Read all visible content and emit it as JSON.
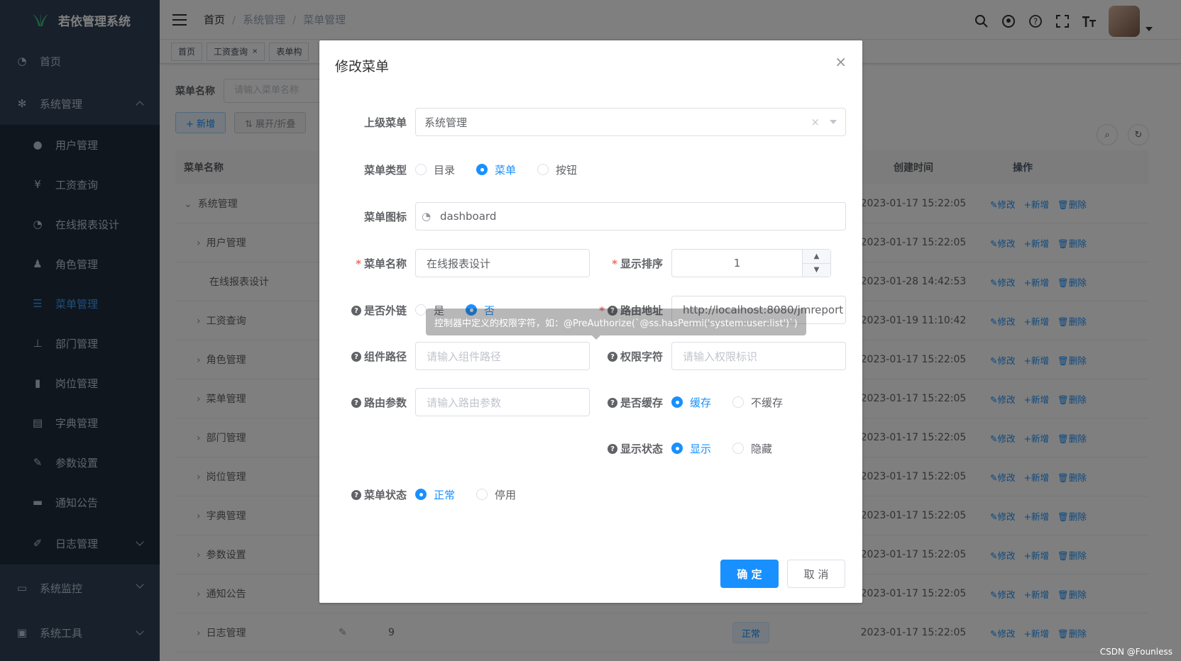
{
  "app": {
    "title": "若依管理系统"
  },
  "sidebar": {
    "items": [
      {
        "label": "首页",
        "icon": "dashboard-icon"
      },
      {
        "label": "系统管理",
        "icon": "gear-icon"
      },
      {
        "label": "系统监控",
        "icon": "monitor-icon"
      },
      {
        "label": "系统工具",
        "icon": "tool-icon"
      }
    ],
    "sub_items": [
      {
        "label": "用户管理",
        "icon": "user-icon"
      },
      {
        "label": "工资查询",
        "icon": "yen-icon"
      },
      {
        "label": "在线报表设计",
        "icon": "dashboard-icon"
      },
      {
        "label": "角色管理",
        "icon": "peoples-icon"
      },
      {
        "label": "菜单管理",
        "icon": "tree-table-icon"
      },
      {
        "label": "部门管理",
        "icon": "tree-icon"
      },
      {
        "label": "岗位管理",
        "icon": "post-icon"
      },
      {
        "label": "字典管理",
        "icon": "dict-icon"
      },
      {
        "label": "参数设置",
        "icon": "edit-icon"
      },
      {
        "label": "通知公告",
        "icon": "message-icon"
      },
      {
        "label": "日志管理",
        "icon": "log-icon"
      }
    ]
  },
  "header": {
    "breadcrumb": [
      "首页",
      "系统管理",
      "菜单管理"
    ],
    "separator": "/"
  },
  "tags": [
    {
      "label": "首页",
      "closable": false
    },
    {
      "label": "工资查询",
      "closable": true
    },
    {
      "label": "表单构",
      "closable": false
    }
  ],
  "page": {
    "search_label": "菜单名称",
    "search_placeholder": "请输入菜单名称",
    "add_button": "+ 新增",
    "expand_button": "⇅ 展开/折叠",
    "columns": {
      "name": "菜单名称",
      "time": "创建时间",
      "ops": "操作"
    },
    "op_edit": "修改",
    "op_add": "新增",
    "op_delete": "删除",
    "rows": [
      {
        "name": "系统管理",
        "expand": "⌄",
        "time": "2023-01-17 15:22:05"
      },
      {
        "name": "用户管理",
        "expand": "›",
        "time": "2023-01-17 15:22:05"
      },
      {
        "name": "在线报表设计",
        "expand": "",
        "time": "2023-01-28 14:42:53"
      },
      {
        "name": "工资查询",
        "expand": "›",
        "time": "2023-01-19 11:10:42"
      },
      {
        "name": "角色管理",
        "expand": "›",
        "time": "2023-01-17 15:22:05"
      },
      {
        "name": "菜单管理",
        "expand": "›",
        "time": "2023-01-17 15:22:05"
      },
      {
        "name": "部门管理",
        "expand": "›",
        "time": "2023-01-17 15:22:05"
      },
      {
        "name": "岗位管理",
        "expand": "›",
        "time": "2023-01-17 15:22:05"
      },
      {
        "name": "字典管理",
        "expand": "›",
        "time": "2023-01-17 15:22:05"
      },
      {
        "name": "参数设置",
        "expand": "›",
        "time": "2023-01-17 15:22:05"
      },
      {
        "name": "通知公告",
        "expand": "›",
        "time": "2023-01-17 15:22:05"
      },
      {
        "name": "日志管理",
        "expand": "›",
        "time": "2023-01-17 15:22:05",
        "sort": "9",
        "status": "正常"
      }
    ]
  },
  "dialog": {
    "title": "修改菜单",
    "parent_label": "上级菜单",
    "parent_value": "系统管理",
    "type_label": "菜单类型",
    "type_options": [
      "目录",
      "菜单",
      "按钮"
    ],
    "type_selected": "菜单",
    "icon_label": "菜单图标",
    "icon_value": "dashboard",
    "name_label": "菜单名称",
    "name_value": "在线报表设计",
    "sort_label": "显示排序",
    "sort_value": "1",
    "external_label": "是否外链",
    "external_options": [
      "是",
      "否"
    ],
    "external_selected": "否",
    "route_label": "路由地址",
    "route_value": "http://localhost:8080/jmreport",
    "component_label": "组件路径",
    "component_placeholder": "请输入组件路径",
    "perm_label": "权限字符",
    "perm_placeholder": "请输入权限标识",
    "query_label": "路由参数",
    "query_placeholder": "请输入路由参数",
    "cache_label": "是否缓存",
    "cache_options": [
      "缓存",
      "不缓存"
    ],
    "cache_selected": "缓存",
    "visible_label": "显示状态",
    "visible_options": [
      "显示",
      "隐藏"
    ],
    "visible_selected": "显示",
    "status_label": "菜单状态",
    "status_options": [
      "正常",
      "停用"
    ],
    "status_selected": "正常",
    "tooltip": "控制器中定义的权限字符，如：@PreAuthorize(`@ss.hasPermi('system:user:list')`)",
    "confirm_button": "确 定",
    "cancel_button": "取 消"
  },
  "watermark": "CSDN @Founless",
  "colors": {
    "primary": "#1890ff",
    "sidebar": "#304156",
    "sidebar_sub": "#1f2d3d",
    "danger": "#f56c6c"
  }
}
